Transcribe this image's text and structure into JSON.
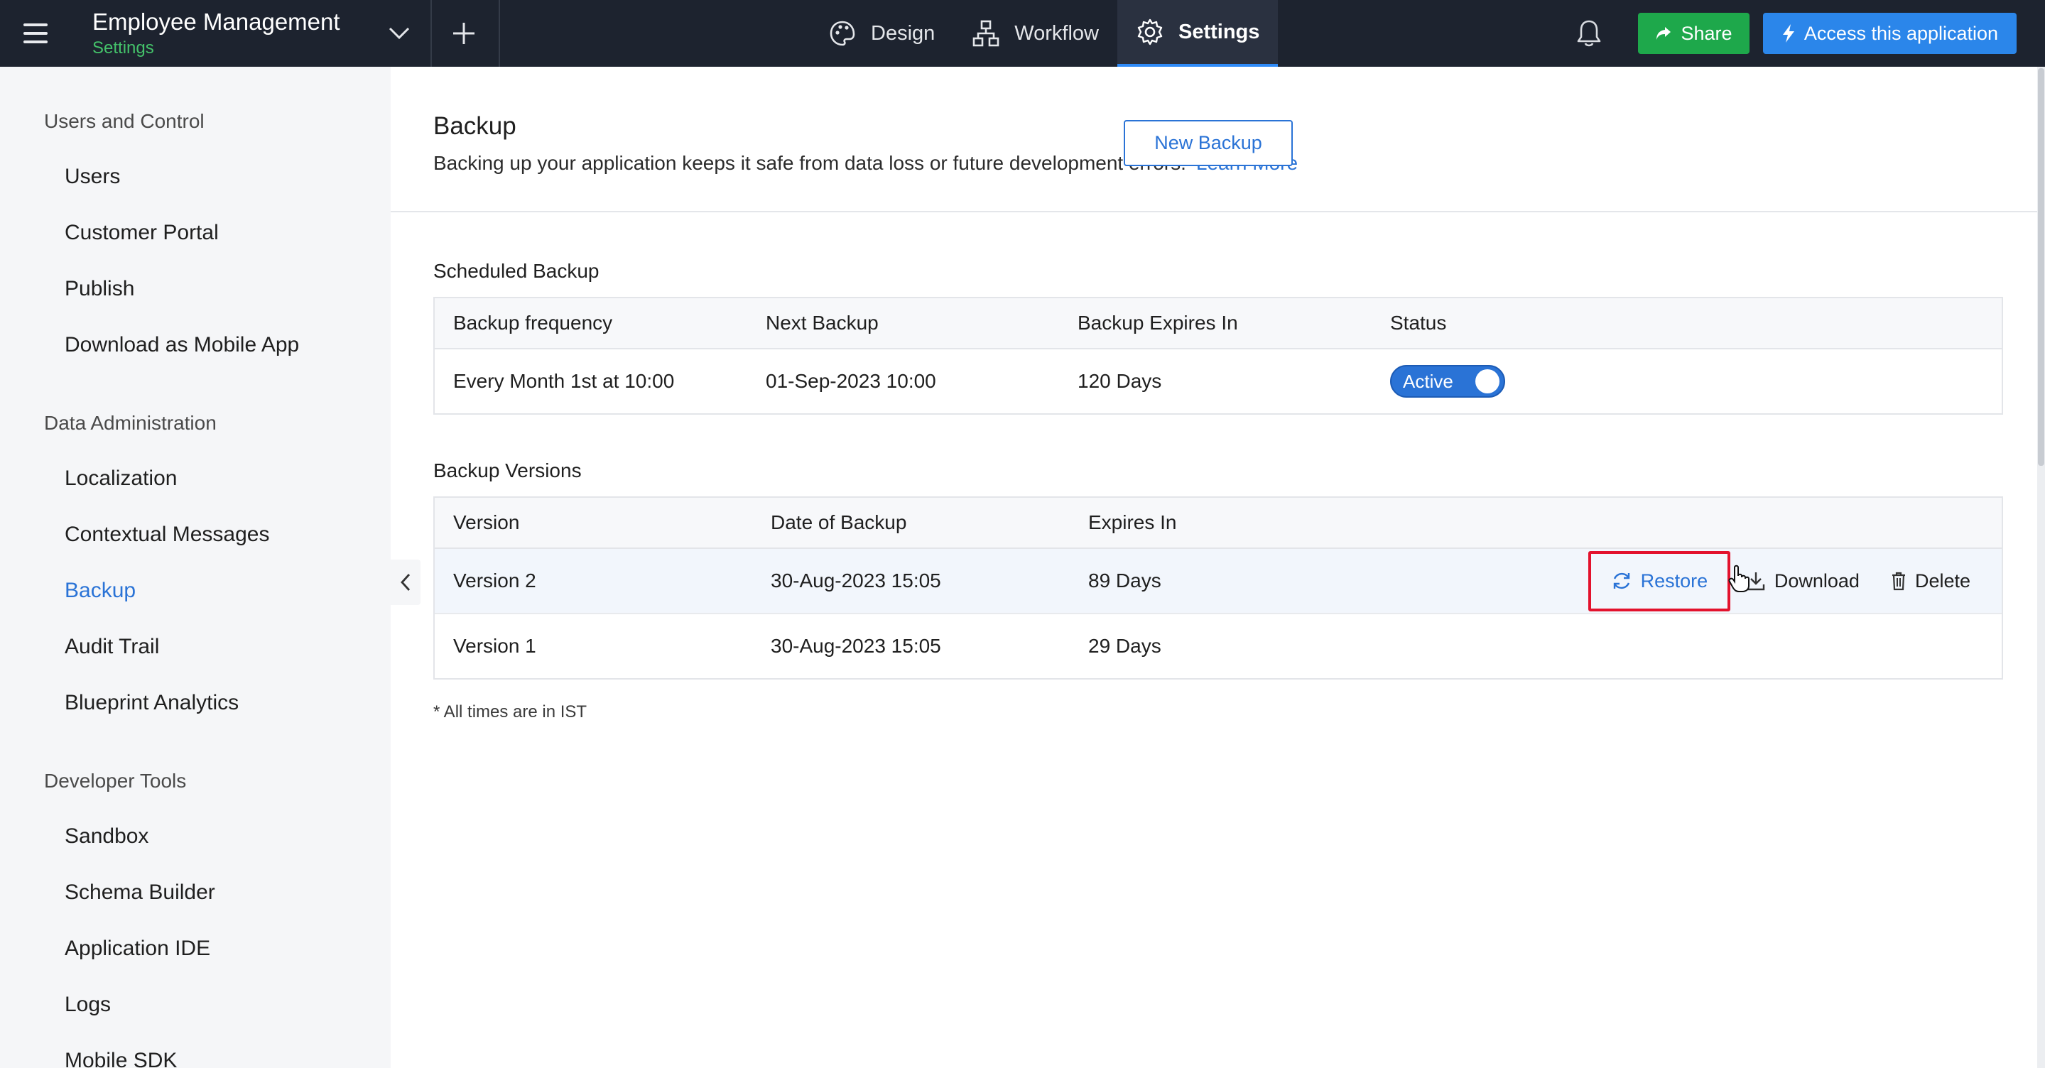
{
  "topbar": {
    "app_title": "Employee Management",
    "app_subtitle": "Settings",
    "nav": [
      {
        "label": "Design",
        "icon": "palette-icon"
      },
      {
        "label": "Workflow",
        "icon": "workflow-icon"
      },
      {
        "label": "Settings",
        "icon": "gear-icon",
        "active": true
      }
    ],
    "share_label": "Share",
    "access_label": "Access this application",
    "colors": {
      "bar": "#1d232f",
      "share": "#1ea84b",
      "access": "#2b86ea",
      "subtitle": "#44c26a"
    }
  },
  "sidebar": {
    "sections": [
      {
        "title": "Users and Control",
        "items": [
          "Users",
          "Customer Portal",
          "Publish",
          "Download as Mobile App"
        ]
      },
      {
        "title": "Data Administration",
        "items": [
          "Localization",
          "Contextual Messages",
          "Backup",
          "Audit Trail",
          "Blueprint Analytics"
        ]
      },
      {
        "title": "Developer Tools",
        "items": [
          "Sandbox",
          "Schema Builder",
          "Application IDE",
          "Logs",
          "Mobile SDK"
        ]
      }
    ],
    "active_item": "Backup"
  },
  "main": {
    "title": "Backup",
    "description": "Backing up your application keeps it safe from data loss or future development errors.",
    "learn_more": "Learn More",
    "new_backup_label": "New Backup",
    "scheduled": {
      "title": "Scheduled Backup",
      "headers": [
        "Backup frequency",
        "Next Backup",
        "Backup Expires In",
        "Status"
      ],
      "row": {
        "frequency": "Every Month 1st at 10:00",
        "next": "01-Sep-2023 10:00",
        "expires": "120 Days",
        "status": "Active"
      }
    },
    "versions": {
      "title": "Backup Versions",
      "headers": [
        "Version",
        "Date of Backup",
        "Expires In"
      ],
      "rows": [
        {
          "version": "Version 2",
          "date": "30-Aug-2023 15:05",
          "expires": "89 Days"
        },
        {
          "version": "Version 1",
          "date": "30-Aug-2023 15:05",
          "expires": "29 Days"
        }
      ],
      "actions": {
        "restore": "Restore",
        "download": "Download",
        "delete": "Delete"
      }
    },
    "footnote": "* All times are in IST"
  }
}
